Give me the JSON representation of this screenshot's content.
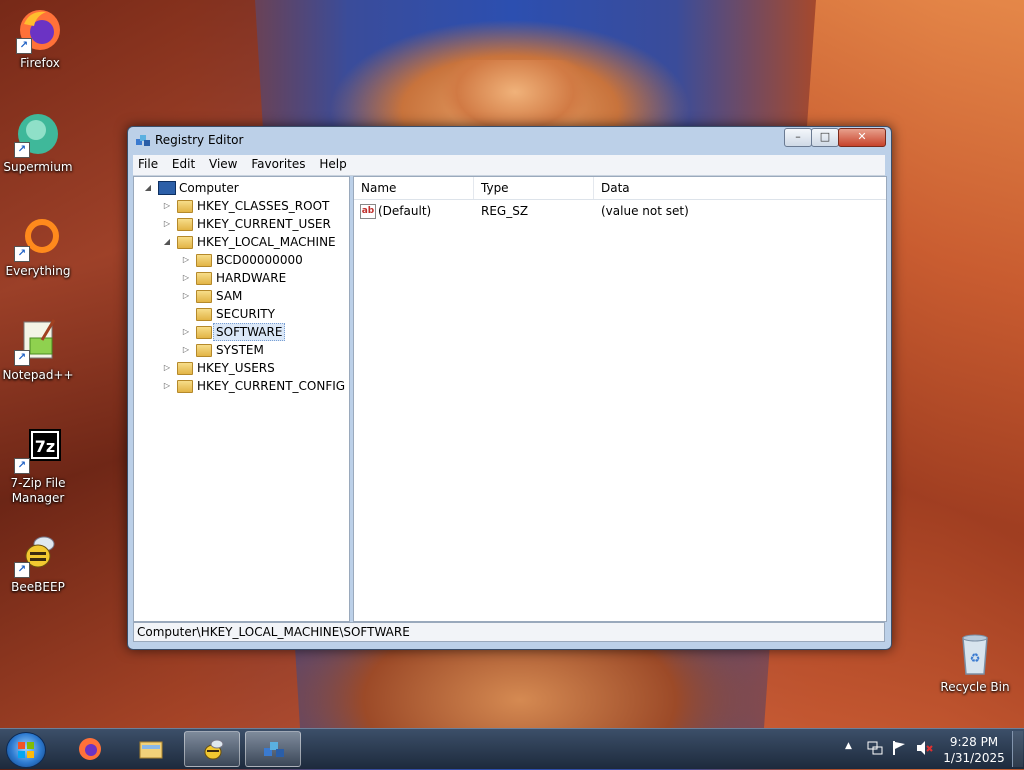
{
  "desktop": {
    "icons": [
      {
        "label": "Firefox"
      },
      {
        "label": "Supermium"
      },
      {
        "label": "Everything"
      },
      {
        "label": "Notepad++"
      },
      {
        "label": "7-Zip File Manager"
      },
      {
        "label": "BeeBEEP"
      },
      {
        "label": "Recycle Bin"
      }
    ]
  },
  "window": {
    "title": "Registry Editor",
    "controls": {
      "minimize": "–",
      "maximize": "□",
      "close": "✕"
    },
    "menu": [
      "File",
      "Edit",
      "View",
      "Favorites",
      "Help"
    ],
    "tree": {
      "root": "Computer",
      "items": [
        {
          "label": "HKEY_CLASSES_ROOT"
        },
        {
          "label": "HKEY_CURRENT_USER"
        },
        {
          "label": "HKEY_LOCAL_MACHINE"
        },
        {
          "label": "BCD00000000"
        },
        {
          "label": "HARDWARE"
        },
        {
          "label": "SAM"
        },
        {
          "label": "SECURITY"
        },
        {
          "label": "SOFTWARE",
          "selected": true
        },
        {
          "label": "SYSTEM"
        },
        {
          "label": "HKEY_USERS"
        },
        {
          "label": "HKEY_CURRENT_CONFIG"
        }
      ]
    },
    "list": {
      "columns": [
        "Name",
        "Type",
        "Data"
      ],
      "rows": [
        {
          "name": "(Default)",
          "type": "REG_SZ",
          "data": "(value not set)"
        }
      ]
    },
    "status": "Computer\\HKEY_LOCAL_MACHINE\\SOFTWARE"
  },
  "taskbar": {
    "clock": {
      "time": "9:28 PM",
      "date": "1/31/2025"
    }
  }
}
